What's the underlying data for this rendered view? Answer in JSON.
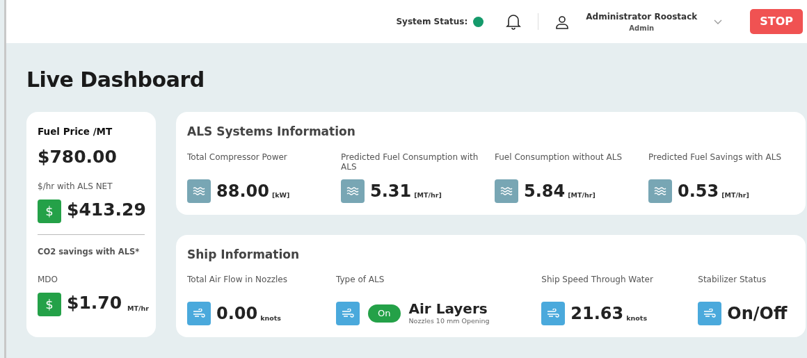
{
  "header": {
    "status_label": "System Status:",
    "status_ok": true,
    "user_name": "Administrator Roostack",
    "user_role": "Admin",
    "stop_button": "STOP"
  },
  "title": "Live Dashboard",
  "fuel_card": {
    "title": "Fuel Price /MT",
    "price": "$780.00",
    "net_label": "$/hr with ALS NET",
    "net_icon": "$",
    "net_value": "$413.29",
    "co2_title": "CO2 savings with ALS*",
    "fuel_type": "MDO",
    "co2_icon": "$",
    "co2_value": "$1.70",
    "co2_unit": "MT/hr"
  },
  "als_info": {
    "title": "ALS Systems Information",
    "metrics": [
      {
        "label": "Total Compressor Power",
        "value": "88.00",
        "unit": "[kW]"
      },
      {
        "label": "Predicted Fuel Consumption with ALS",
        "value": "5.31",
        "unit": "[MT/hr]"
      },
      {
        "label": "Fuel Consumption without ALS",
        "value": "5.84",
        "unit": "[MT/hr]"
      },
      {
        "label": "Predicted Fuel Savings with ALS",
        "value": "0.53",
        "unit": "[MT/hr]"
      }
    ]
  },
  "ship_info": {
    "title": "Ship Information",
    "metrics": [
      {
        "kind": "value",
        "label": "Total Air Flow in Nozzles",
        "value": "0.00",
        "unit": "knots"
      },
      {
        "kind": "toggle",
        "label": "Type of ALS",
        "toggle": "On",
        "on": true,
        "value": "Air Layers",
        "note": "Nozzles 10 mm Opening"
      },
      {
        "kind": "value",
        "label": "Ship Speed Through Water",
        "value": "21.63",
        "unit": "knots"
      },
      {
        "kind": "value",
        "label": "Stabilizer Status",
        "value": "On/Off"
      }
    ]
  }
}
